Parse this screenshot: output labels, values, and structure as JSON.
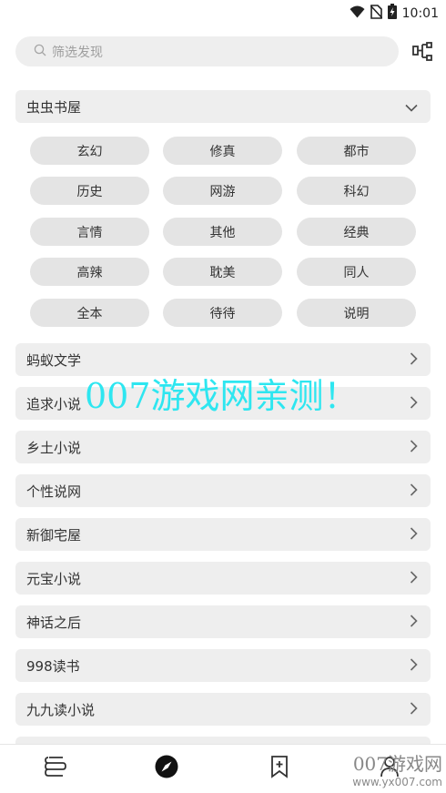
{
  "status_bar": {
    "time": "10:01",
    "icons": [
      "wifi-icon",
      "no-sim-icon",
      "battery-charging-icon"
    ]
  },
  "search": {
    "placeholder": "筛选发现",
    "icon": "search-icon"
  },
  "filter_button": {
    "icon": "source-tree-icon"
  },
  "group": {
    "title": "虫虫书屋",
    "icon": "chevron-down-icon",
    "tags": [
      "玄幻",
      "修真",
      "都市",
      "历史",
      "网游",
      "科幻",
      "言情",
      "其他",
      "经典",
      "高辣",
      "耽美",
      "同人",
      "全本",
      "待待",
      "说明"
    ]
  },
  "sources": [
    "蚂蚁文学",
    "追求小说",
    "乡土小说",
    "个性说网",
    "新御宅屋",
    "元宝小说",
    "神话之后",
    "998读书",
    "九九读小说"
  ],
  "watermark": {
    "text": "007游戏网亲测！",
    "corner_title": "007游戏网",
    "corner_url": "www.yx007.com"
  },
  "bottom_nav": [
    {
      "name": "bookshelf",
      "icon": "bookshelf-icon"
    },
    {
      "name": "discover",
      "icon": "compass-icon"
    },
    {
      "name": "bookmark",
      "icon": "bookmark-add-icon"
    },
    {
      "name": "profile",
      "icon": "user-icon"
    }
  ],
  "colors": {
    "row_background": "#eeeeee",
    "tag_background": "#e4e4e4",
    "watermark": "#2ee6f0"
  }
}
